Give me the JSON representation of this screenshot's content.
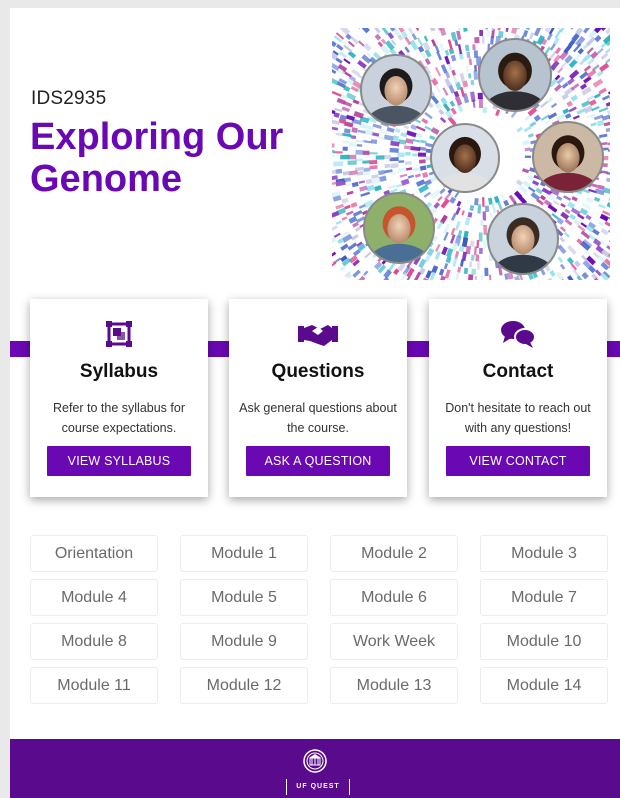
{
  "course": {
    "code": "IDS2935",
    "title": "Exploring Our Genome"
  },
  "collage": {
    "description_icon": "genome-collage",
    "accent_colors": [
      "#6a08b3",
      "#2bb3c0",
      "#e0468b",
      "#3a57c4",
      "#8ee0ec"
    ]
  },
  "cards": [
    {
      "icon": "syllabus-icon",
      "title": "Syllabus",
      "text": "Refer to the syllabus for course expectations.",
      "button": "VIEW SYLLABUS"
    },
    {
      "icon": "handshake-icon",
      "title": "Questions",
      "text": "Ask general questions about the course.",
      "button": "ASK A QUESTION"
    },
    {
      "icon": "chat-icon",
      "title": "Contact",
      "text": "Don't hesitate to reach out with any questions!",
      "button": "VIEW CONTACT"
    }
  ],
  "modules": [
    "Orientation",
    "Module 1",
    "Module 2",
    "Module 3",
    "Module 4",
    "Module 5",
    "Module 6",
    "Module 7",
    "Module 8",
    "Module 9",
    "Work Week",
    "Module 10",
    "Module 11",
    "Module 12",
    "Module 13",
    "Module 14"
  ],
  "footer": {
    "brand": "UF QUEST",
    "logo_icon": "uf-seal-icon"
  },
  "colors": {
    "accent": "#6a08b3",
    "footer": "#5a0a8c"
  }
}
